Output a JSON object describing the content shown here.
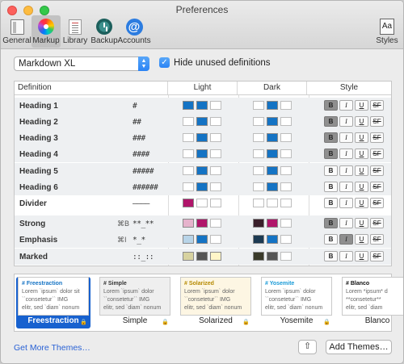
{
  "window": {
    "title": "Preferences"
  },
  "toolbar": {
    "items": [
      {
        "label": "General",
        "icon": "general-icon"
      },
      {
        "label": "Markup",
        "icon": "markup-icon"
      },
      {
        "label": "Library",
        "icon": "library-icon"
      },
      {
        "label": "Backup",
        "icon": "backup-icon"
      },
      {
        "label": "Accounts",
        "icon": "accounts-icon"
      }
    ],
    "styles_label": "Styles",
    "styles_icon_text": "Aa",
    "accounts_icon_text": "@"
  },
  "controls": {
    "flavor": "Markdown XL",
    "hide_unused_label": "Hide unused definitions",
    "hide_unused_checked": true
  },
  "table": {
    "headers": {
      "definition": "Definition",
      "light": "Light",
      "dark": "Dark",
      "style": "Style"
    },
    "style_buttons": [
      "B",
      "I",
      "U",
      "SF"
    ],
    "rows": [
      {
        "name": "Heading 1",
        "shortcut": "",
        "syntax": "#",
        "light": [
          "#1473c4",
          "#1473c4",
          "#ffffff"
        ],
        "dark": [
          "#ffffff",
          "#1473c4",
          "#ffffff"
        ],
        "on": [
          "B"
        ]
      },
      {
        "name": "Heading 2",
        "shortcut": "",
        "syntax": "##",
        "light": [
          "#ffffff",
          "#1473c4",
          "#ffffff"
        ],
        "dark": [
          "#ffffff",
          "#1473c4",
          "#ffffff"
        ],
        "on": [
          "B"
        ]
      },
      {
        "name": "Heading 3",
        "shortcut": "",
        "syntax": "###",
        "light": [
          "#ffffff",
          "#1473c4",
          "#ffffff"
        ],
        "dark": [
          "#ffffff",
          "#1473c4",
          "#ffffff"
        ],
        "on": [
          "B"
        ]
      },
      {
        "name": "Heading 4",
        "shortcut": "",
        "syntax": "####",
        "light": [
          "#ffffff",
          "#1473c4",
          "#ffffff"
        ],
        "dark": [
          "#ffffff",
          "#1473c4",
          "#ffffff"
        ],
        "on": [
          "B"
        ]
      },
      {
        "name": "Heading 5",
        "shortcut": "",
        "syntax": "#####",
        "light": [
          "#ffffff",
          "#1473c4",
          "#ffffff"
        ],
        "dark": [
          "#ffffff",
          "#1473c4",
          "#ffffff"
        ],
        "on": []
      },
      {
        "name": "Heading 6",
        "shortcut": "",
        "syntax": "######",
        "light": [
          "#ffffff",
          "#1473c4",
          "#ffffff"
        ],
        "dark": [
          "#ffffff",
          "#1473c4",
          "#ffffff"
        ],
        "on": []
      },
      {
        "name": "Divider",
        "shortcut": "",
        "syntax": "––––",
        "light": [
          "#b0156a",
          "#ffffff",
          "#ffffff"
        ],
        "dark": [
          "#ffffff",
          "#ffffff",
          "#ffffff"
        ],
        "on": []
      },
      {
        "name": "Strong",
        "shortcut": "⌘B",
        "syntax": "**_**",
        "light": [
          "#e6b3cc",
          "#b0156a",
          "#ffffff"
        ],
        "dark": [
          "#3a1f2a",
          "#b0156a",
          "#ffffff"
        ],
        "on": [
          "B"
        ]
      },
      {
        "name": "Emphasis",
        "shortcut": "⌘I",
        "syntax": "*_*",
        "light": [
          "#b8d4e8",
          "#1473c4",
          "#ffffff"
        ],
        "dark": [
          "#1c3a52",
          "#1473c4",
          "#ffffff"
        ],
        "on": [
          "I"
        ]
      },
      {
        "name": "Marked",
        "shortcut": "",
        "syntax": "::_::",
        "light": [
          "#d7d2a0",
          "#555555",
          "#fff6c8"
        ],
        "dark": [
          "#3a3a2a",
          "#555555",
          "#ffffff"
        ],
        "on": []
      }
    ]
  },
  "themes": [
    {
      "name": "Freestraction",
      "title": "# Freestraction",
      "l2": "Lorem `ipsum` dolor sit",
      "l3": "``consetetur``  IMG",
      "l4": "elitr, sed `diam` nonum",
      "bg": "#ffffff",
      "accent": "#1473c4",
      "selected": true
    },
    {
      "name": "Simple",
      "title": "# Simple",
      "l2": "Lorem `ipsum` dolor",
      "l3": "``consetetur``  IMG",
      "l4": "elitr, sed `diam` nonum",
      "bg": "#efefef",
      "accent": "#333333",
      "selected": false
    },
    {
      "name": "Solarized",
      "title": "# Solarized",
      "l2": "Lorem `ipsum` dolor",
      "l3": "``consetetur``  IMG",
      "l4": "elitr, sed `diam` nonum",
      "bg": "#fdf6e3",
      "accent": "#b58900",
      "selected": false
    },
    {
      "name": "Yosemite",
      "title": "# Yosemite",
      "l2": "Lorem `ipsum` dolor",
      "l3": "``consetetur``  IMG",
      "l4": "elitr, sed `diam` nonum",
      "bg": "#ffffff",
      "accent": "#1a9bd7",
      "selected": false
    },
    {
      "name": "Blanco",
      "title": "# Blanco",
      "l2": "Lorem *ipsum* d",
      "l3": "**consetetur**",
      "l4": "elitr, sed `diam",
      "bg": "#ffffff",
      "accent": "#111111",
      "selected": false
    }
  ],
  "footer": {
    "get_more": "Get More Themes…",
    "add_themes": "Add Themes…"
  }
}
